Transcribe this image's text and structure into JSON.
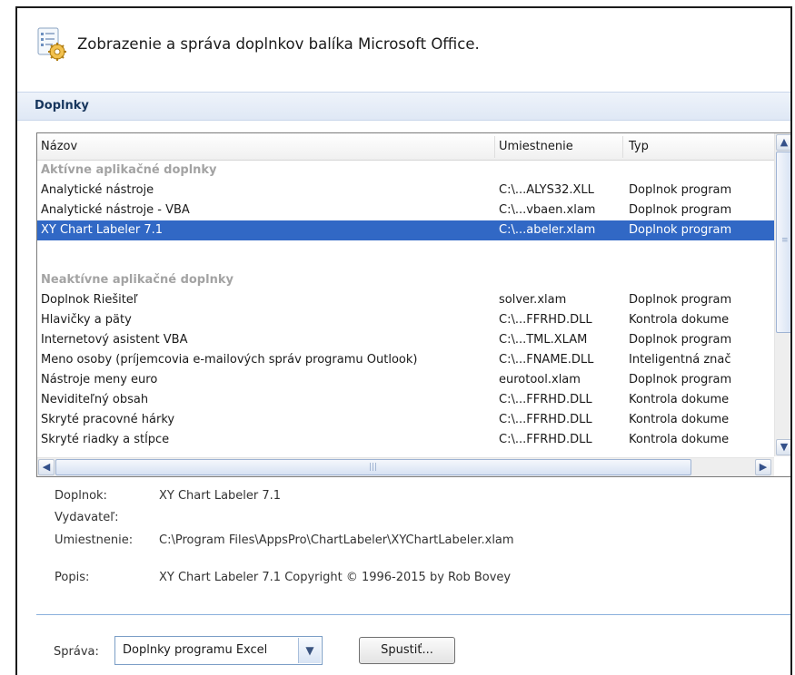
{
  "header": {
    "title": "Zobrazenie a správa doplnkov balíka Microsoft Office.",
    "icon": "addins-gear-icon"
  },
  "section": {
    "title": "Doplnky"
  },
  "list": {
    "columns": [
      "Názov",
      "Umiestnenie",
      "Typ"
    ],
    "groups": [
      {
        "title": "Aktívne aplikačné doplnky",
        "rows": [
          [
            "Analytické nástroje",
            "C:\\...ALYS32.XLL",
            "Doplnok program"
          ],
          [
            "Analytické nástroje - VBA",
            "C:\\...vbaen.xlam",
            "Doplnok program"
          ],
          [
            "XY Chart Labeler 7.1",
            "C:\\...abeler.xlam",
            "Doplnok program"
          ]
        ]
      },
      {
        "title": "Neaktívne aplikačné doplnky",
        "rows": [
          [
            "Doplnok Riešiteľ",
            "solver.xlam",
            "Doplnok program"
          ],
          [
            "Hlavičky a päty",
            "C:\\...FFRHD.DLL",
            "Kontrola dokume"
          ],
          [
            "Internetový asistent VBA",
            "C:\\...TML.XLAM",
            "Doplnok program"
          ],
          [
            "Meno osoby (príjemcovia e-mailových správ programu Outlook)",
            "C:\\...FNAME.DLL",
            "Inteligentná znač"
          ],
          [
            "Nástroje meny euro",
            "eurotool.xlam",
            "Doplnok program"
          ],
          [
            "Neviditeľný obsah",
            "C:\\...FFRHD.DLL",
            "Kontrola dokume"
          ],
          [
            "Skryté pracovné hárky",
            "C:\\...FFRHD.DLL",
            "Kontrola dokume"
          ],
          [
            "Skryté riadky a stĺpce",
            "C:\\...FFRHD.DLL",
            "Kontrola dokume"
          ]
        ]
      }
    ]
  },
  "details": {
    "addin_label": "Doplnok:",
    "addin_value": "XY Chart Labeler 7.1",
    "publisher_label": "Vydavateľ:",
    "publisher_value": "",
    "location_label": "Umiestnenie:",
    "location_value": "C:\\Program Files\\AppsPro\\ChartLabeler\\XYChartLabeler.xlam",
    "description_label": "Popis:",
    "description_value": "XY Chart Labeler 7.1 Copyright © 1996-2015 by Rob Bovey"
  },
  "footer": {
    "manage_label": "Správa:",
    "manage_select_value": "Doplnky programu Excel",
    "go_button": "Spustiť..."
  },
  "colors": {
    "selection": "#3168c5",
    "section_bar": "#dfe8f5",
    "group_header": "#a3a3a3"
  }
}
